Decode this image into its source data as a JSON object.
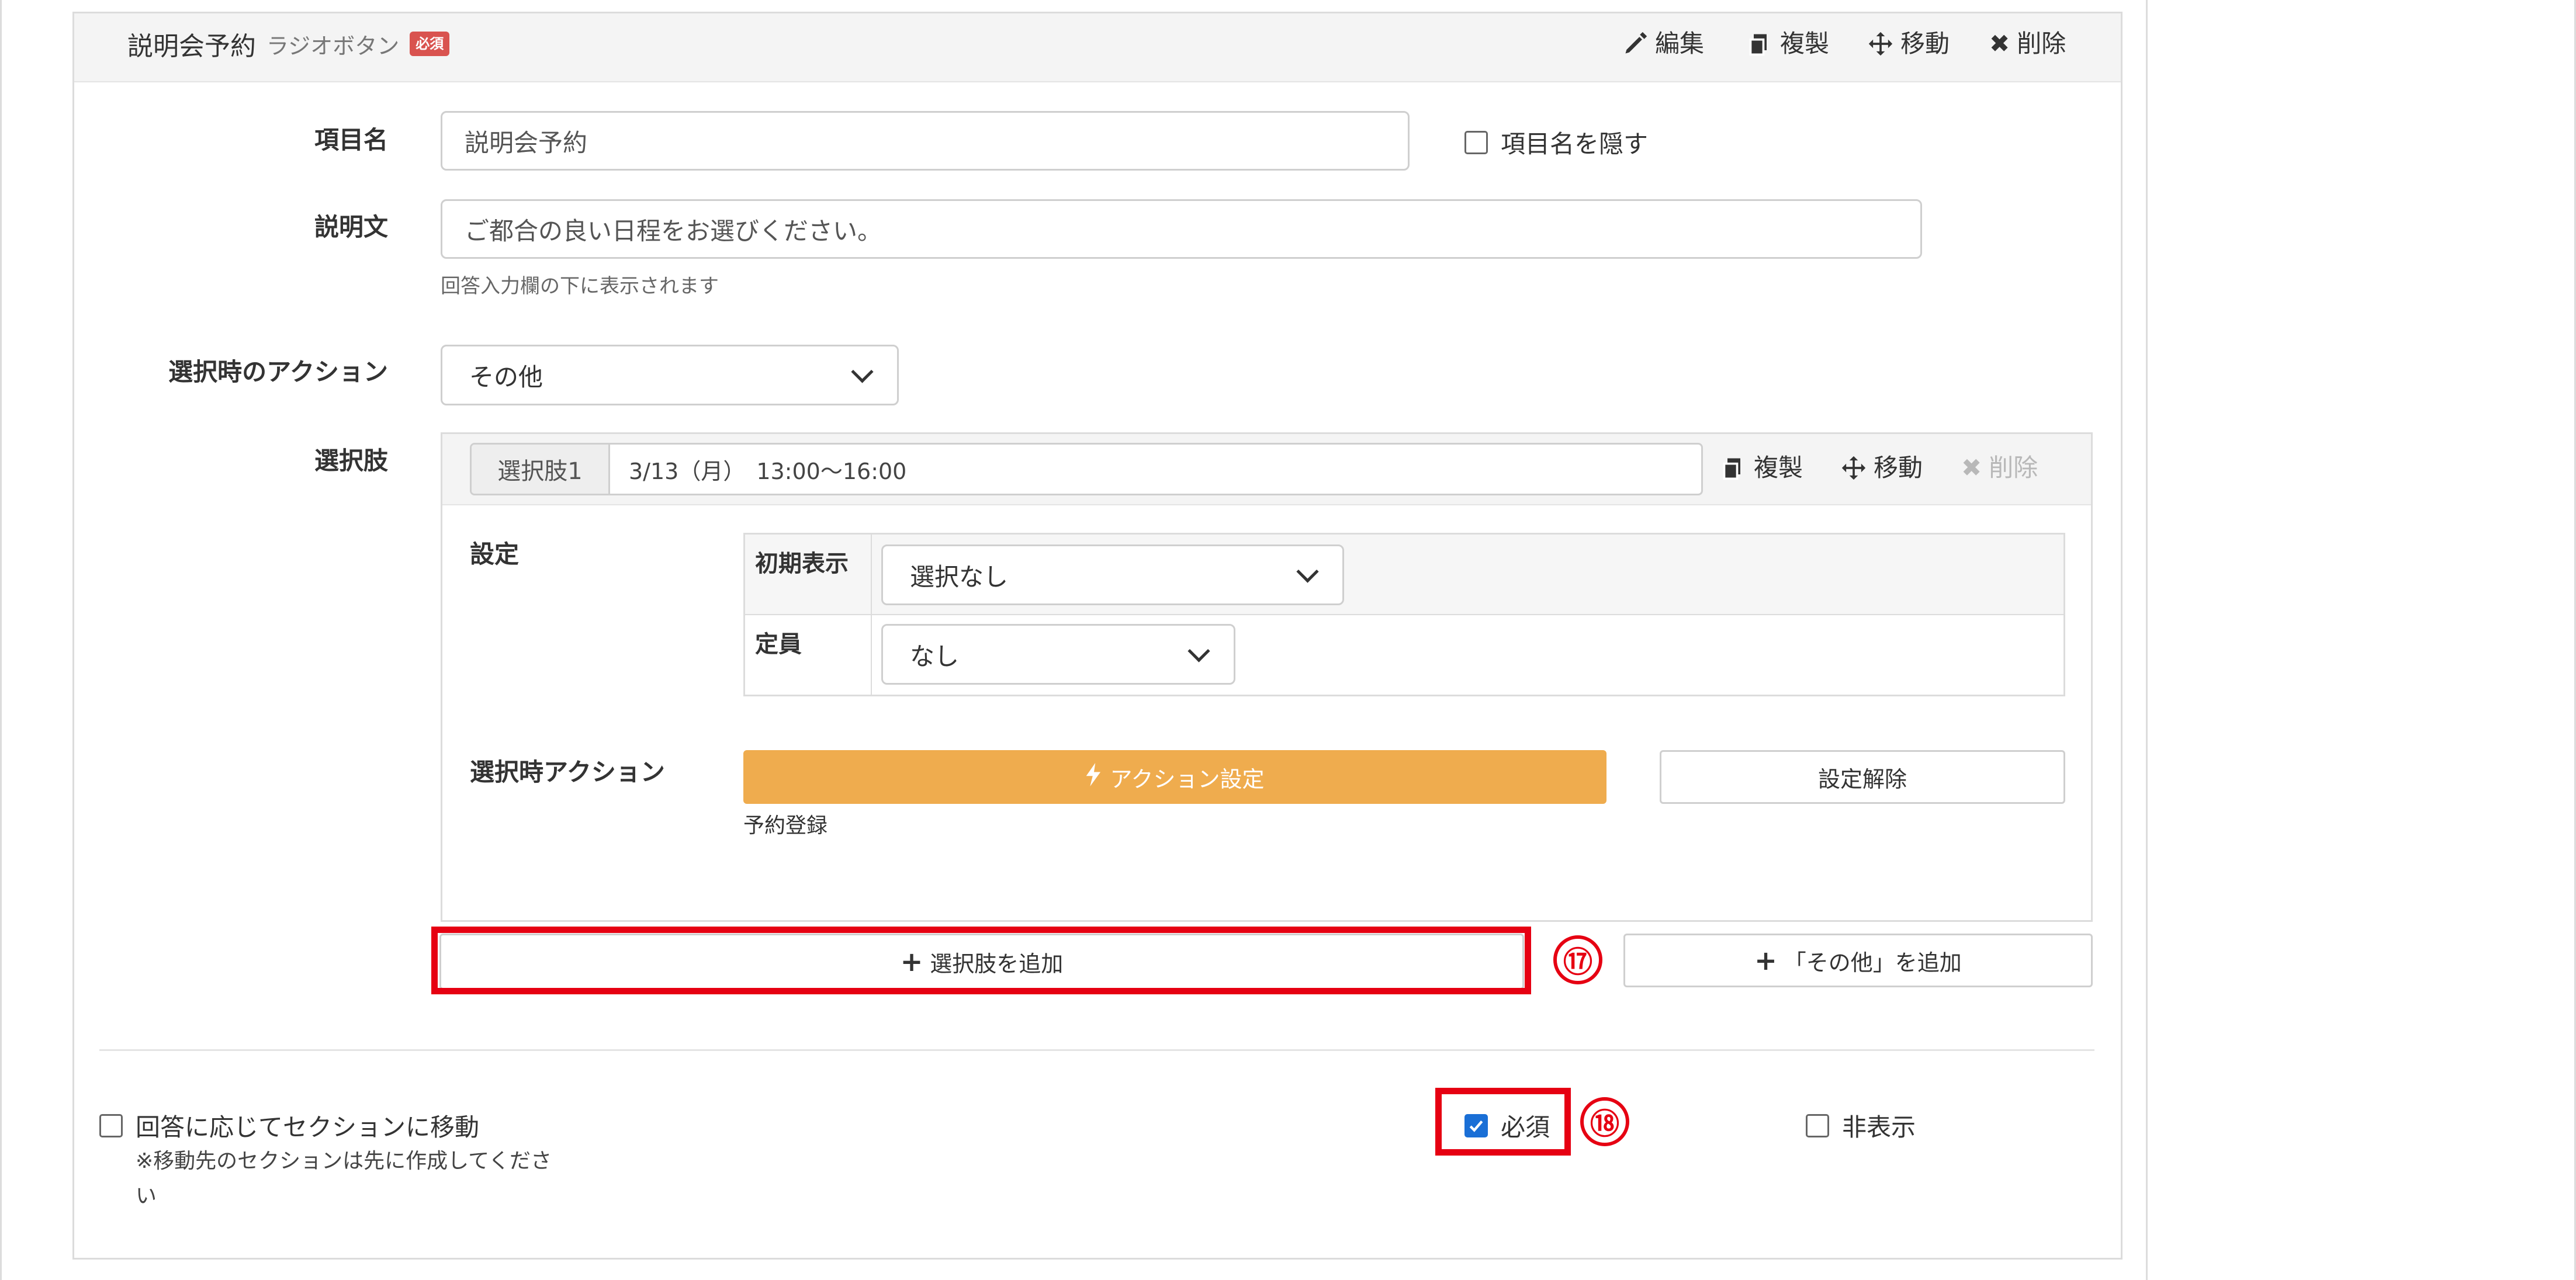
{
  "header": {
    "title": "説明会予約",
    "type": "ラジオボタン",
    "badge": "必須",
    "tools": {
      "edit": "編集",
      "duplicate": "複製",
      "move": "移動",
      "delete": "削除"
    }
  },
  "form": {
    "item_name_label": "項目名",
    "item_name_value": "説明会予約",
    "hide_name_label": "項目名を隠す",
    "description_label": "説明文",
    "description_value": "ご都合の良い日程をお選びください。",
    "description_help": "回答入力欄の下に表示されます",
    "action_label": "選択時のアクション",
    "action_value": "その他",
    "choices_label": "選択肢"
  },
  "choice": {
    "tag": "選択肢1",
    "value": "3/13（月）　13:00〜16:00",
    "tools": {
      "duplicate": "複製",
      "move": "移動",
      "delete": "削除"
    },
    "settings_label": "設定",
    "initial_display_label": "初期表示",
    "initial_display_value": "選択なし",
    "capacity_label": "定員",
    "capacity_value": "なし",
    "action_label": "選択時アクション",
    "action_button": "アクション設定",
    "clear_button": "設定解除",
    "action_note": "予約登録"
  },
  "buttons": {
    "add_choice": "選択肢を追加",
    "add_other": "「その他」を追加"
  },
  "footer": {
    "move_section_label": "回答に応じてセクションに移動",
    "move_section_note": "※移動先のセクションは先に作成してください",
    "required_label": "必須",
    "hidden_label": "非表示"
  },
  "annotations": {
    "n17": "⑰",
    "n18": "⑱"
  },
  "colors": {
    "accent_orange": "#efac4e",
    "badge_red": "#d9534f",
    "annotation_red": "#e60012",
    "checkbox_blue": "#1a6fd6"
  },
  "state": {
    "required_checked": true,
    "hide_name_checked": false,
    "move_section_checked": false,
    "hidden_checked": false
  }
}
